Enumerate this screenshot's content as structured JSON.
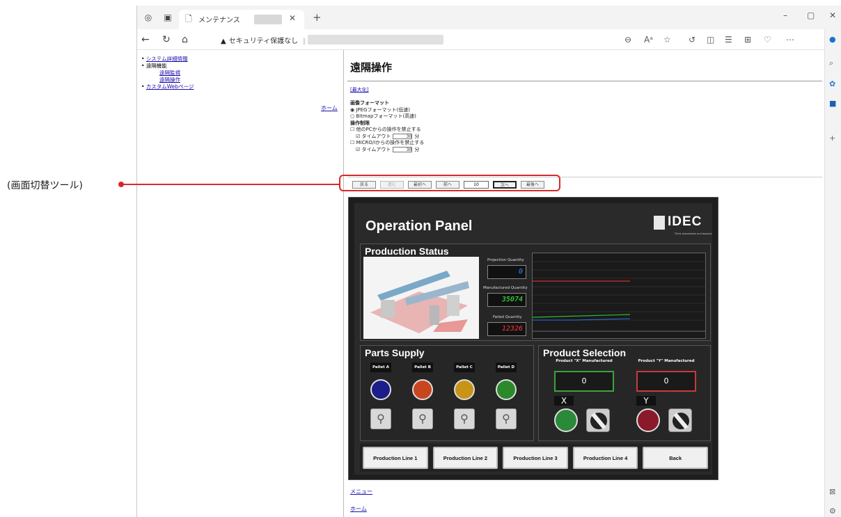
{
  "callout": "(画面切替ツール)",
  "browser": {
    "tab_title": "メンテナンス",
    "security_text": "セキュリティ保護なし",
    "security_sep": "|"
  },
  "leftnav": {
    "items": [
      {
        "label": "システム詳細情報",
        "link": true
      },
      {
        "label": "遠隔機能",
        "link": false
      },
      {
        "label": "遠隔監視",
        "link": true,
        "sub": true
      },
      {
        "label": "遠隔操作",
        "link": true,
        "sub": true
      },
      {
        "label": "カスタムWebページ",
        "link": true
      }
    ],
    "home": "ホーム"
  },
  "main": {
    "title": "遠隔操作",
    "maximize": "[最大化]",
    "image_format_heading": "画像フォーマット",
    "jpeg_option": "JPEGフォーマット(低速)",
    "bitmap_option": "Bitmapフォーマット(高速)",
    "control_heading": "操作制限",
    "pc_block": "他のPCからの操作を禁止する",
    "micro_block": "MICRO/Iからの操作を禁止する",
    "timeout_label": "タイムアウト",
    "timeout_value": "30",
    "timeout_unit": "分",
    "menu": "メニュー",
    "home": "ホーム"
  },
  "switcher": {
    "back": "戻る",
    "forward": "進む",
    "first": "最初へ",
    "prev": "前へ",
    "page": "10",
    "next": "次へ",
    "last": "最後へ"
  },
  "hmi": {
    "title": "Operation Panel",
    "logo": "IDEC",
    "logo_tag": "Think Automation and beyond.",
    "production_status": "Production Status",
    "projection_label": "Projection Quantity",
    "projection_value": "0",
    "manufactured_label": "Manufactured Quantity",
    "manufactured_value": "35074",
    "failed_label": "Failed Quantity",
    "failed_value": "12326",
    "parts_supply": "Parts Supply",
    "pallets": [
      "Pallet A",
      "Pallet B",
      "Pallet C",
      "Pallet D"
    ],
    "pallet_colors": [
      "#1c1c8a",
      "#c8461e",
      "#c89418",
      "#2a8a2a"
    ],
    "product_selection": "Product Selection",
    "product_x_label": "Product \"X\" Manufactured",
    "product_x_value": "0",
    "product_y_label": "Product \"Y\" Manufactured",
    "product_y_value": "0",
    "x": "X",
    "y": "Y",
    "line_buttons": [
      "Production Line 1",
      "Production Line 2",
      "Production Line 3",
      "Production Line 4",
      "Back"
    ]
  }
}
